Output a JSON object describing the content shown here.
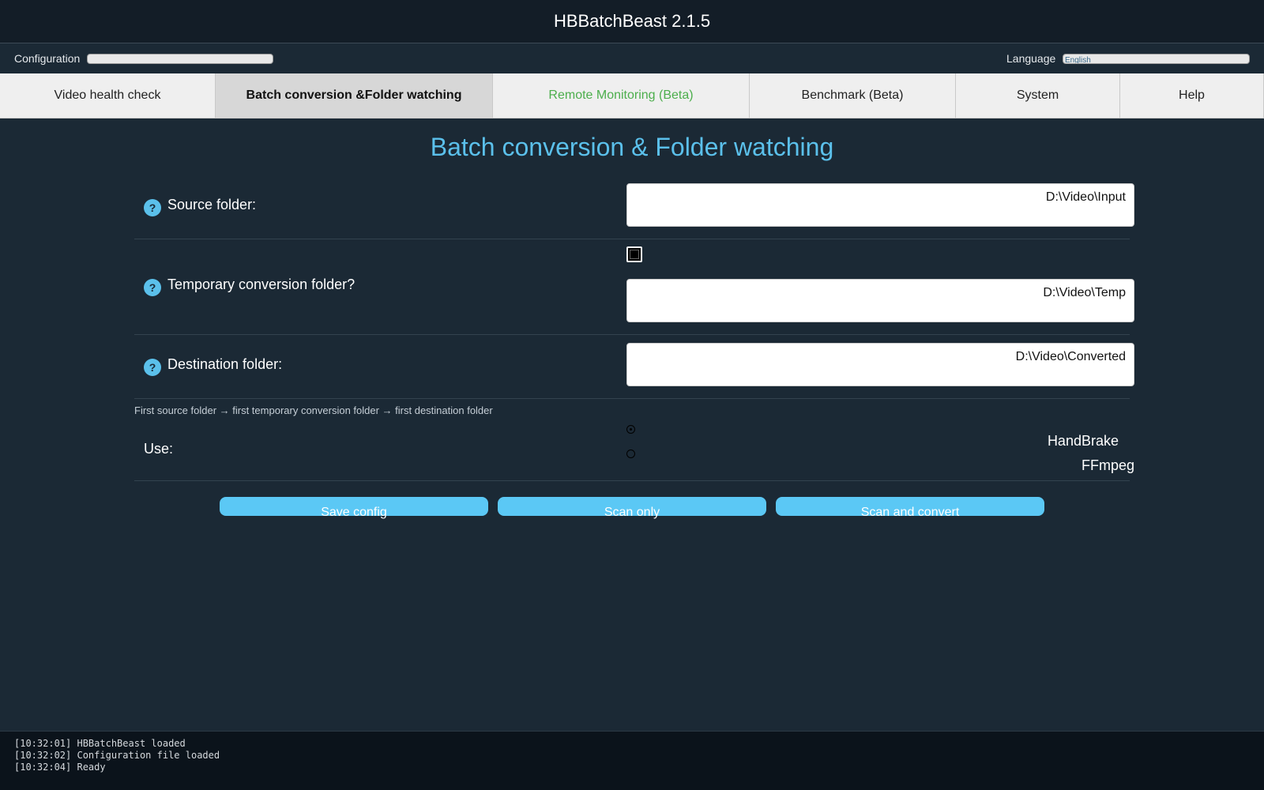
{
  "app": {
    "title": "HBBatchBeast 2.1.5"
  },
  "config_bar": {
    "config_label": "Configuration",
    "language_label": "Language",
    "language_value": "English"
  },
  "tabs": [
    {
      "label": "Video health check"
    },
    {
      "label": "Batch conversion &Folder watching"
    },
    {
      "label": "Remote Monitoring (Beta)"
    },
    {
      "label": "Benchmark (Beta)"
    },
    {
      "label": "System"
    },
    {
      "label": "Help"
    }
  ],
  "active_tab": "Batch conversion &Folder watching",
  "main": {
    "title": "Batch conversion & Folder watching",
    "help_glyph": "?",
    "source": {
      "label": "Source folder:",
      "value": "D:\\Video\\Input"
    },
    "temp": {
      "label": "Temporary conversion folder?",
      "checked": true,
      "value": "D:\\Video\\Temp"
    },
    "destination": {
      "label": "Destination folder:",
      "value": "D:\\Video\\Converted"
    },
    "hint": "First source folder → first temporary conversion folder → first destination folder",
    "use": {
      "label": "Use:",
      "options": [
        "HandBrake",
        "FFmpeg"
      ],
      "selected": "HandBrake"
    }
  },
  "buttons": {
    "save": "Save config",
    "scan": "Scan only",
    "scan_convert": "Scan and convert"
  },
  "log": [
    "[10:32:01] HBBatchBeast loaded",
    "[10:32:02] Configuration file loaded",
    "[10:32:04] Ready"
  ],
  "colors": {
    "accent": "#5bc0eb",
    "button": "#5bc8f5",
    "background": "#1b2935",
    "beta_tab": "#4cae4c"
  }
}
